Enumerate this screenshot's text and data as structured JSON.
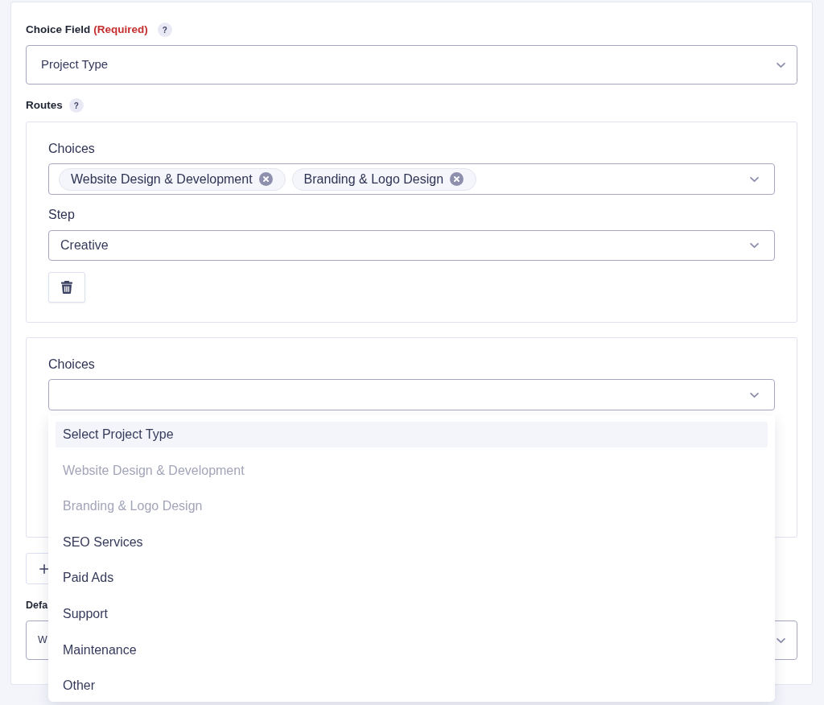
{
  "choice_field": {
    "label": "Choice Field",
    "required_note": "(Required)",
    "help": "?",
    "value": "Project Type"
  },
  "routes": {
    "label": "Routes",
    "help": "?",
    "items": [
      {
        "choices_label": "Choices",
        "choices": [
          "Website Design & Development",
          "Branding & Logo Design"
        ],
        "step_label": "Step",
        "step_value": "Creative"
      },
      {
        "choices_label": "Choices",
        "expanded": true,
        "options": [
          {
            "label": "Select Project Type",
            "selected": true,
            "disabled": false
          },
          {
            "label": "Website Design & Development",
            "selected": false,
            "disabled": true
          },
          {
            "label": "Branding & Logo Design",
            "selected": false,
            "disabled": true
          },
          {
            "label": "SEO Services",
            "selected": false,
            "disabled": false
          },
          {
            "label": "Paid Ads",
            "selected": false,
            "disabled": false
          },
          {
            "label": "Support",
            "selected": false,
            "disabled": false
          },
          {
            "label": "Maintenance",
            "selected": false,
            "disabled": false
          },
          {
            "label": "Other",
            "selected": false,
            "disabled": false
          }
        ]
      }
    ]
  },
  "default_field": {
    "label": "Defa",
    "value": "W"
  }
}
